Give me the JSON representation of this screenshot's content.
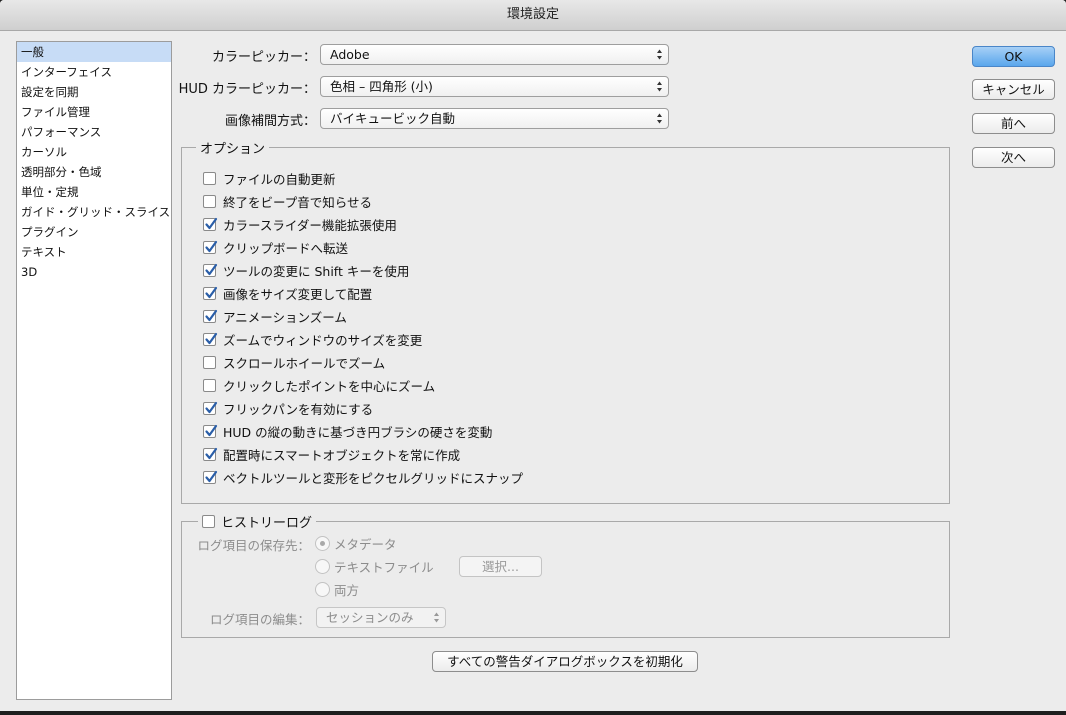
{
  "window": {
    "title": "環境設定"
  },
  "sidebar": {
    "items": [
      {
        "label": "一般",
        "selected": true
      },
      {
        "label": "インターフェイス"
      },
      {
        "label": "設定を同期"
      },
      {
        "label": "ファイル管理"
      },
      {
        "label": "パフォーマンス"
      },
      {
        "label": "カーソル"
      },
      {
        "label": "透明部分・色域"
      },
      {
        "label": "単位・定規"
      },
      {
        "label": "ガイド・グリッド・スライス"
      },
      {
        "label": "プラグイン"
      },
      {
        "label": "テキスト"
      },
      {
        "label": "3D"
      }
    ]
  },
  "general": {
    "color_picker": {
      "label": "カラーピッカー：",
      "value": "Adobe"
    },
    "hud_color_picker": {
      "label": "HUD カラーピッカー：",
      "value": "色相 – 四角形 (小)"
    },
    "interpolation": {
      "label": "画像補間方式：",
      "value": "バイキュービック自動"
    }
  },
  "options": {
    "title": "オプション",
    "items": [
      {
        "label": "ファイルの自動更新",
        "checked": false
      },
      {
        "label": "終了をビープ音で知らせる",
        "checked": false
      },
      {
        "label": "カラースライダー機能拡張使用",
        "checked": true
      },
      {
        "label": "クリップボードへ転送",
        "checked": true
      },
      {
        "label": "ツールの変更に Shift キーを使用",
        "checked": true
      },
      {
        "label": "画像をサイズ変更して配置",
        "checked": true
      },
      {
        "label": "アニメーションズーム",
        "checked": true
      },
      {
        "label": "ズームでウィンドウのサイズを変更",
        "checked": true
      },
      {
        "label": "スクロールホイールでズーム",
        "checked": false
      },
      {
        "label": "クリックしたポイントを中心にズーム",
        "checked": false
      },
      {
        "label": "フリックパンを有効にする",
        "checked": true
      },
      {
        "label": "HUD の縦の動きに基づき円ブラシの硬さを変動",
        "checked": true
      },
      {
        "label": "配置時にスマートオブジェクトを常に作成",
        "checked": true
      },
      {
        "label": "ベクトルツールと変形をピクセルグリッドにスナップ",
        "checked": true
      }
    ]
  },
  "history_log": {
    "title": "ヒストリーログ",
    "checked": false,
    "save_to_label": "ログ項目の保存先：",
    "save_options": [
      {
        "label": "メタデータ",
        "selected": true
      },
      {
        "label": "テキストファイル",
        "selected": false
      },
      {
        "label": "両方",
        "selected": false
      }
    ],
    "choose_button": "選択...",
    "edit_label": "ログ項目の編集：",
    "edit_value": "セッションのみ"
  },
  "reset_warnings_button": "すべての警告ダイアログボックスを初期化",
  "buttons": {
    "ok": "OK",
    "cancel": "キャンセル",
    "prev": "前へ",
    "next": "次へ"
  },
  "colors": {
    "accent": "#5aa6ec",
    "selection": "#c7dcf6",
    "checkmark": "#2a5ea8"
  },
  "icons": {
    "checkmark": "checkmark-icon",
    "select_arrows": "updown-arrows-icon"
  }
}
